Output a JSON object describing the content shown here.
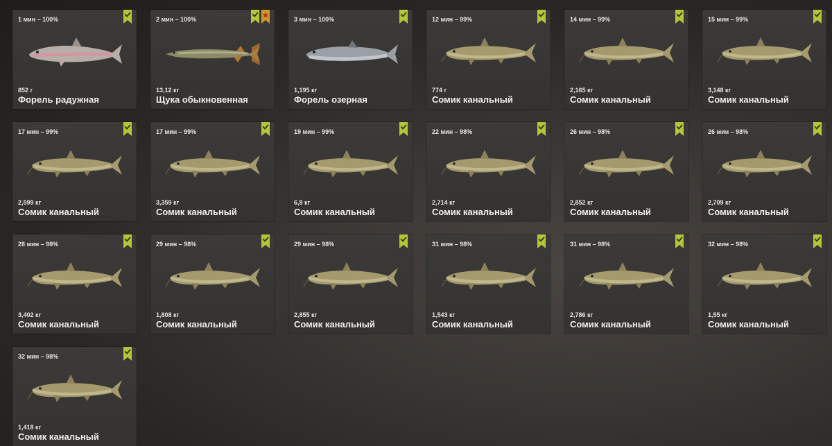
{
  "colors": {
    "badge_green": "#b5c53a",
    "badge_star": "#c99a2e",
    "star_red": "#d0281e",
    "catfish_body": "#a59a6e",
    "trout_body": "#b7aea8",
    "pike_body": "#8c8a68",
    "laketrout_body": "#9aa0a6"
  },
  "catches": [
    {
      "time": "1 мин – 100%",
      "weight": "852 г",
      "name": "Форель радужная",
      "fish_icon": "rainbow-trout",
      "badges": [
        "check"
      ]
    },
    {
      "time": "2 мин – 100%",
      "weight": "13,12 кг",
      "name": "Щука обыкновенная",
      "fish_icon": "pike",
      "badges": [
        "check",
        "star"
      ]
    },
    {
      "time": "3 мин – 100%",
      "weight": "1,195 кг",
      "name": "Форель озерная",
      "fish_icon": "lake-trout",
      "badges": [
        "check"
      ]
    },
    {
      "time": "12 мин – 99%",
      "weight": "774 г",
      "name": "Сомик канальный",
      "fish_icon": "channel-catfish",
      "badges": [
        "check"
      ]
    },
    {
      "time": "14 мин – 99%",
      "weight": "2,165 кг",
      "name": "Сомик канальный",
      "fish_icon": "channel-catfish",
      "badges": [
        "check"
      ]
    },
    {
      "time": "15 мин – 99%",
      "weight": "3,148 кг",
      "name": "Сомик канальный",
      "fish_icon": "channel-catfish",
      "badges": [
        "check"
      ]
    },
    {
      "time": "17 мин – 99%",
      "weight": "2,599 кг",
      "name": "Сомик канальный",
      "fish_icon": "channel-catfish",
      "badges": [
        "check"
      ]
    },
    {
      "time": "17 мин – 99%",
      "weight": "3,359 кг",
      "name": "Сомик канальный",
      "fish_icon": "channel-catfish",
      "badges": [
        "check"
      ]
    },
    {
      "time": "19 мин – 99%",
      "weight": "6,8 кг",
      "name": "Сомик канальный",
      "fish_icon": "channel-catfish",
      "badges": [
        "check"
      ]
    },
    {
      "time": "22 мин – 98%",
      "weight": "2,714 кг",
      "name": "Сомик канальный",
      "fish_icon": "channel-catfish",
      "badges": [
        "check"
      ]
    },
    {
      "time": "26 мин – 98%",
      "weight": "2,852 кг",
      "name": "Сомик канальный",
      "fish_icon": "channel-catfish",
      "badges": [
        "check"
      ]
    },
    {
      "time": "26 мин – 98%",
      "weight": "2,709 кг",
      "name": "Сомик канальный",
      "fish_icon": "channel-catfish",
      "badges": [
        "check"
      ]
    },
    {
      "time": "28 мин – 98%",
      "weight": "3,402 кг",
      "name": "Сомик канальный",
      "fish_icon": "channel-catfish",
      "badges": [
        "check"
      ]
    },
    {
      "time": "29 мин – 98%",
      "weight": "1,808 кг",
      "name": "Сомик канальный",
      "fish_icon": "channel-catfish",
      "badges": [
        "check"
      ]
    },
    {
      "time": "29 мин – 98%",
      "weight": "2,855 кг",
      "name": "Сомик канальный",
      "fish_icon": "channel-catfish",
      "badges": [
        "check"
      ]
    },
    {
      "time": "31 мин – 98%",
      "weight": "1,543 кг",
      "name": "Сомик канальный",
      "fish_icon": "channel-catfish",
      "badges": [
        "check"
      ]
    },
    {
      "time": "31 мин – 98%",
      "weight": "2,786 кг",
      "name": "Сомик канальный",
      "fish_icon": "channel-catfish",
      "badges": [
        "check"
      ]
    },
    {
      "time": "32 мин – 98%",
      "weight": "1,55 кг",
      "name": "Сомик канальный",
      "fish_icon": "channel-catfish",
      "badges": [
        "check"
      ]
    },
    {
      "time": "32 мин – 98%",
      "weight": "1,418 кг",
      "name": "Сомик канальный",
      "fish_icon": "channel-catfish",
      "badges": [
        "check"
      ]
    }
  ]
}
